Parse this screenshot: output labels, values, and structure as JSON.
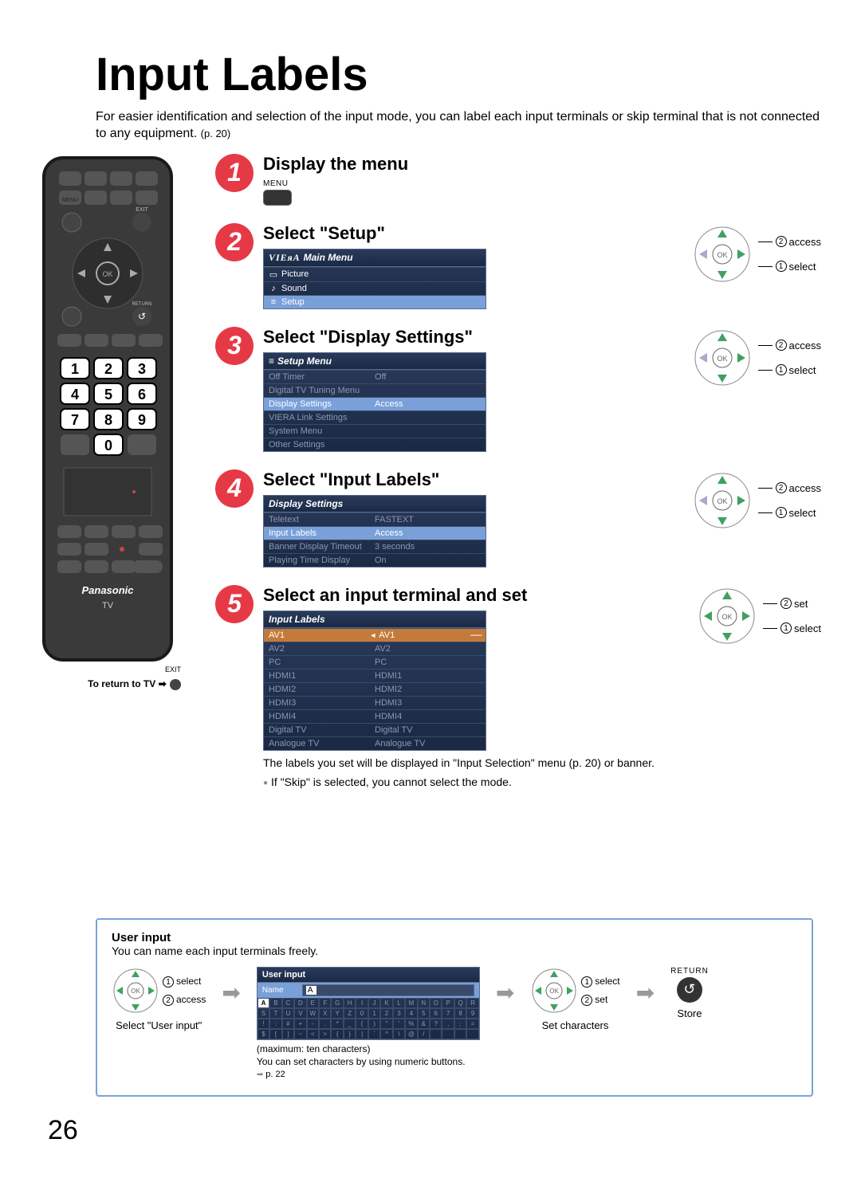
{
  "title": "Input Labels",
  "subtitle_line1": "For easier identification and selection of the input mode, you can label each input terminals or skip terminal that is not connected to any equipment.",
  "subtitle_ref": "(p. 20)",
  "remote": {
    "brand": "Panasonic",
    "sub": "TV",
    "return_line": "To return to TV ➡",
    "exit": "EXIT",
    "menu": "MENU",
    "ok": "OK",
    "returnlbl": "RETURN"
  },
  "labels": {
    "access": "access",
    "select": "select",
    "set": "set"
  },
  "step1": {
    "title": "Display the menu",
    "menu_label": "MENU"
  },
  "step2": {
    "title": "Select \"Setup\"",
    "osd_title": "Main Menu",
    "osd_brand": "VIEᴙA",
    "items": [
      {
        "icon": "▭",
        "label": "Picture"
      },
      {
        "icon": "♪",
        "label": "Sound"
      },
      {
        "icon": "≡",
        "label": "Setup"
      }
    ]
  },
  "step3": {
    "title": "Select \"Display Settings\"",
    "osd_title": "Setup Menu",
    "icon": "≡",
    "rows": [
      {
        "k": "Off Timer",
        "v": "Off",
        "muted": true
      },
      {
        "k": "Digital TV Tuning Menu",
        "v": "",
        "muted": true
      },
      {
        "k": "Display Settings",
        "v": "Access",
        "sel": true
      },
      {
        "k": "VIERA Link Settings",
        "v": "",
        "muted": true
      },
      {
        "k": "System Menu",
        "v": "",
        "muted": true
      },
      {
        "k": "Other Settings",
        "v": "",
        "muted": true
      }
    ]
  },
  "step4": {
    "title": "Select \"Input Labels\"",
    "osd_title": "Display Settings",
    "rows": [
      {
        "k": "Teletext",
        "v": "FASTEXT",
        "muted": true
      },
      {
        "k": "Input Labels",
        "v": "Access",
        "sel": true
      },
      {
        "k": "Banner Display Timeout",
        "v": "3 seconds",
        "muted": true
      },
      {
        "k": "Playing Time Display",
        "v": "On",
        "muted": true
      }
    ]
  },
  "step5": {
    "title": "Select an input terminal and set",
    "osd_title": "Input Labels",
    "rows": [
      {
        "k": "AV1",
        "v": "AV1",
        "arrows": true,
        "dashes": true,
        "selorange": true
      },
      {
        "k": "AV2",
        "v": "AV2",
        "muted": true
      },
      {
        "k": "PC",
        "v": "PC",
        "muted": true
      },
      {
        "k": "HDMI1",
        "v": "HDMI1",
        "muted": true
      },
      {
        "k": "HDMI2",
        "v": "HDMI2",
        "muted": true
      },
      {
        "k": "HDMI3",
        "v": "HDMI3",
        "muted": true
      },
      {
        "k": "HDMI4",
        "v": "HDMI4",
        "muted": true
      },
      {
        "k": "Digital TV",
        "v": "Digital TV",
        "muted": true
      },
      {
        "k": "Analogue TV",
        "v": "Analogue TV",
        "muted": true
      }
    ],
    "note1": "The labels you set will be displayed in \"Input Selection\" menu (p. 20) or banner.",
    "note2": "If \"Skip\" is selected, you cannot select the mode."
  },
  "user_input": {
    "title": "User input",
    "sub": "You can name each input terminals freely.",
    "col1_lbl": "Select \"User input\"",
    "charbox_title": "User input",
    "name_label": "Name",
    "name_value": "A",
    "grid": [
      "A",
      "B",
      "C",
      "D",
      "E",
      "F",
      "G",
      "H",
      "I",
      "J",
      "K",
      "L",
      "M",
      "N",
      "O",
      "P",
      "Q",
      "R",
      "S",
      "T",
      "U",
      "V",
      "W",
      "X",
      "Y",
      "Z",
      "0",
      "1",
      "2",
      "3",
      "4",
      "5",
      "6",
      "7",
      "8",
      "9",
      "!",
      ":",
      "#",
      "+",
      "-",
      ".",
      "*",
      "_",
      "(",
      ")",
      "\"",
      "'",
      "%",
      "&",
      "?",
      ",",
      ";",
      "=",
      "$",
      "[",
      "]",
      "~",
      "<",
      ">",
      "{",
      "}",
      "|",
      "`",
      "^",
      "\\",
      "@",
      "/",
      " ",
      " ",
      " ",
      " "
    ],
    "note_max": "(maximum: ten characters)",
    "note_chars": "You can set characters by using numeric buttons.",
    "note_ref": "p. 22",
    "col3_lbl": "Set characters",
    "return_btn_lbl": "RETURN",
    "store_lbl": "Store"
  },
  "page_number": "26"
}
